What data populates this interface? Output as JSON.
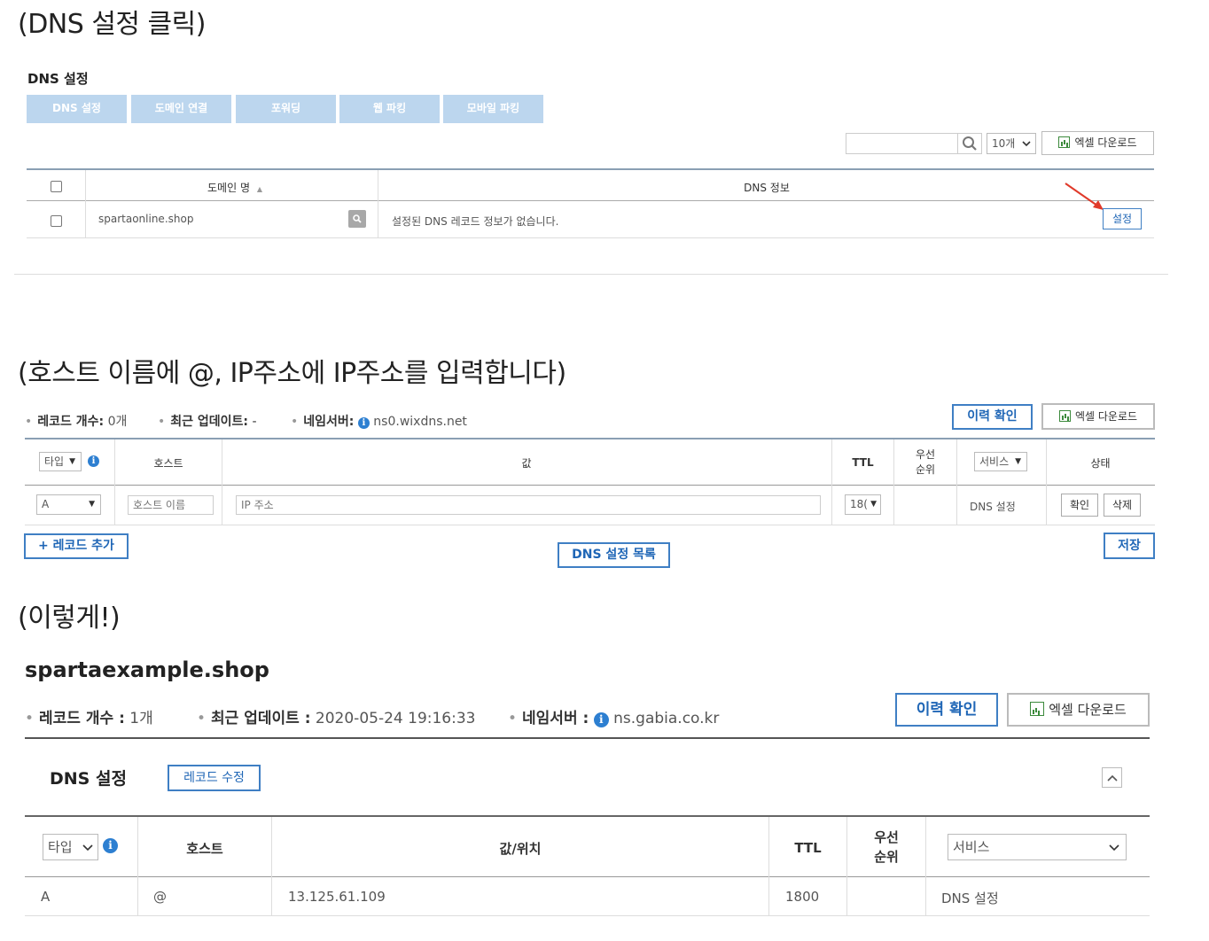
{
  "captions": {
    "c1": "(DNS 설정 클릭)",
    "c2": "(호스트 이름에 @, IP주소에 IP주소를 입력합니다)",
    "c3": "(이렇게!)"
  },
  "s1": {
    "title": "DNS 설정",
    "tabs": [
      "DNS 설정",
      "도메인 연결",
      "포워딩",
      "웹 파킹",
      "모바일 파킹"
    ],
    "page_size": "10개",
    "excel": "엑셀 다운로드",
    "col_domain": "도메인 명",
    "sort_glyph": "▲",
    "col_dns": "DNS 정보",
    "row_domain": "spartaonline.shop",
    "row_info": "설정된 DNS 레코드 정보가 없습니다.",
    "setting_btn": "설정"
  },
  "s2": {
    "record_count_label": "레코드 개수:",
    "record_count": "0개",
    "update_label": "최근 업데이트:",
    "update_value": "-",
    "ns_label": "네임서버:",
    "ns_value": "ns0.wixdns.net",
    "history_btn": "이력 확인",
    "excel": "엑셀 다운로드",
    "th_type": "타입",
    "th_host": "호스트",
    "th_value": "값",
    "th_ttl": "TTL",
    "th_priority_1": "우선",
    "th_priority_2": "순위",
    "th_service": "서비스",
    "th_status": "상태",
    "row_type": "A",
    "host_placeholder": "호스트 이름",
    "ip_placeholder": "IP 주소",
    "ttl": "18(",
    "service": "DNS 설정",
    "confirm_btn": "확인",
    "delete_btn": "삭제",
    "add_record": "+ 레코드 추가",
    "dns_list": "DNS 설정 목록",
    "save": "저장"
  },
  "s3": {
    "domain": "spartaexample.shop",
    "record_count_label": "레코드 개수 :",
    "record_count": "1개",
    "update_label": "최근 업데이트 :",
    "update_value": "2020-05-24 19:16:33",
    "ns_label": "네임서버 :",
    "ns_value": "ns.gabia.co.kr",
    "history_btn": "이력 확인",
    "excel": "엑셀 다운로드",
    "section_title": "DNS 설정",
    "edit_btn": "레코드 수정",
    "th_type": "타입",
    "th_host": "호스트",
    "th_value": "값/위치",
    "th_ttl": "TTL",
    "th_priority_1": "우선",
    "th_priority_2": "순위",
    "th_service": "서비스",
    "row": {
      "type": "A",
      "host": "@",
      "value": "13.125.61.109",
      "ttl": "1800",
      "priority": "",
      "service": "DNS 설정"
    }
  },
  "colors": {
    "accent": "#1f66b6",
    "tab_bg": "#bcd6ee",
    "arrow": "#e03a2a",
    "info": "#2d7fd1"
  }
}
